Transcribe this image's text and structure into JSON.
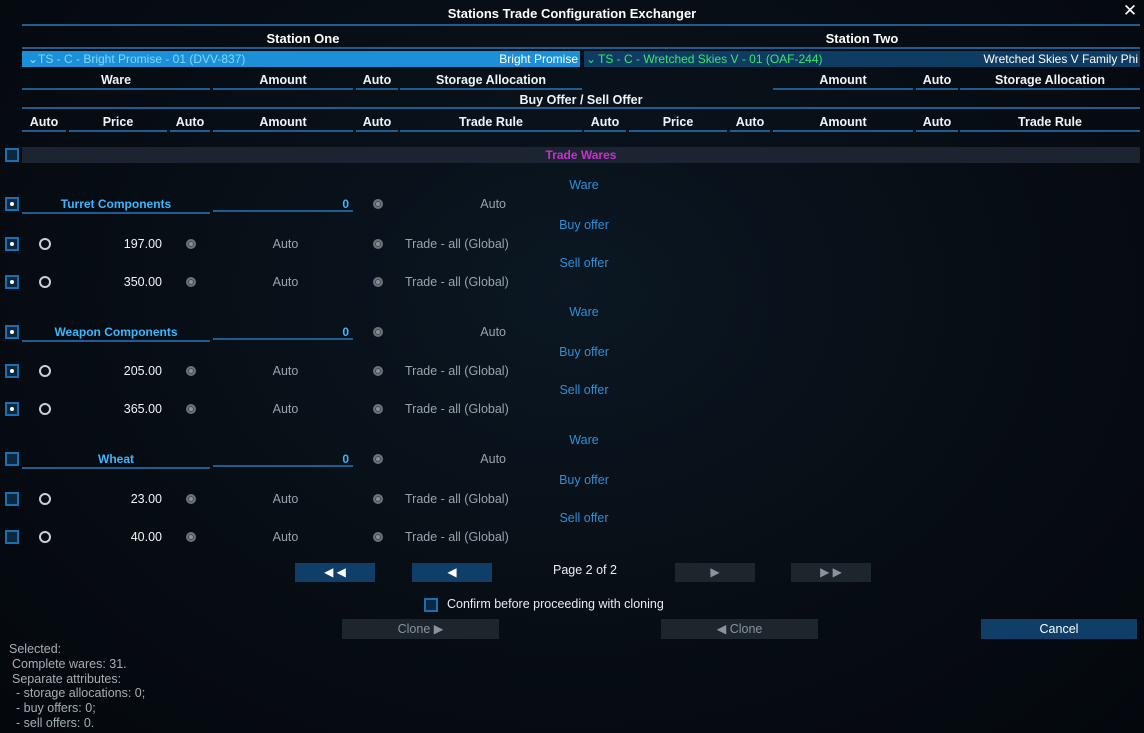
{
  "window": {
    "title": "Stations Trade Configuration Exchanger",
    "close_glyph": "✕"
  },
  "stations": {
    "one": {
      "label": "Station One",
      "selected": "TS - C - Bright Promise - 01 (DVV-837)",
      "name": "Bright Promise"
    },
    "two": {
      "label": "Station Two",
      "selected": "TS - C - Wretched Skies V - 01 (OAF-244)",
      "name": "Wretched Skies V Family Phi"
    }
  },
  "headers": {
    "ware": "Ware",
    "amount": "Amount",
    "auto": "Auto",
    "storage": "Storage Allocation",
    "offer": "Buy Offer / Sell Offer",
    "price": "Price",
    "trade_rule": "Trade Rule"
  },
  "trade_wares_label": "Trade Wares",
  "groups": [
    {
      "name": "Turret Components",
      "amount": "0",
      "storage": "Auto",
      "type_labels": [
        "Ware",
        "Buy offer",
        "Sell offer"
      ],
      "buy": {
        "price": "197.00",
        "amount": "Auto",
        "rule": "Trade - all (Global)"
      },
      "sell": {
        "price": "350.00",
        "amount": "Auto",
        "rule": "Trade - all (Global)"
      }
    },
    {
      "name": "Weapon Components",
      "amount": "0",
      "storage": "Auto",
      "type_labels": [
        "Ware",
        "Buy offer",
        "Sell offer"
      ],
      "buy": {
        "price": "205.00",
        "amount": "Auto",
        "rule": "Trade - all (Global)"
      },
      "sell": {
        "price": "365.00",
        "amount": "Auto",
        "rule": "Trade - all (Global)"
      }
    },
    {
      "name": "Wheat",
      "amount": "0",
      "storage": "Auto",
      "type_labels": [
        "Ware",
        "Buy offer",
        "Sell offer"
      ],
      "buy": {
        "price": "23.00",
        "amount": "Auto",
        "rule": "Trade - all (Global)"
      },
      "sell": {
        "price": "40.00",
        "amount": "Auto",
        "rule": "Trade - all (Global)"
      }
    }
  ],
  "pagination": {
    "first": "◀ ◀",
    "prev": "◀",
    "info": "Page 2 of 2",
    "next": "▶",
    "last": "▶ ▶"
  },
  "confirm_label": "Confirm before proceeding with cloning",
  "buttons": {
    "clone_right": "Clone  ▶",
    "clone_left": "◀   Clone",
    "cancel": "Cancel"
  },
  "summary": {
    "selected": "Selected:",
    "complete": "Complete wares: 31.",
    "separate": "Separate attributes:",
    "storage": "- storage allocations: 0;",
    "buy": "- buy offers: 0;",
    "sell": "- sell offers: 0."
  },
  "colors": {
    "accent": "#1b90d8",
    "group_text": "#39b7ff",
    "trade_wares": "#c92fd2",
    "station_two_text": "#35e86a"
  }
}
